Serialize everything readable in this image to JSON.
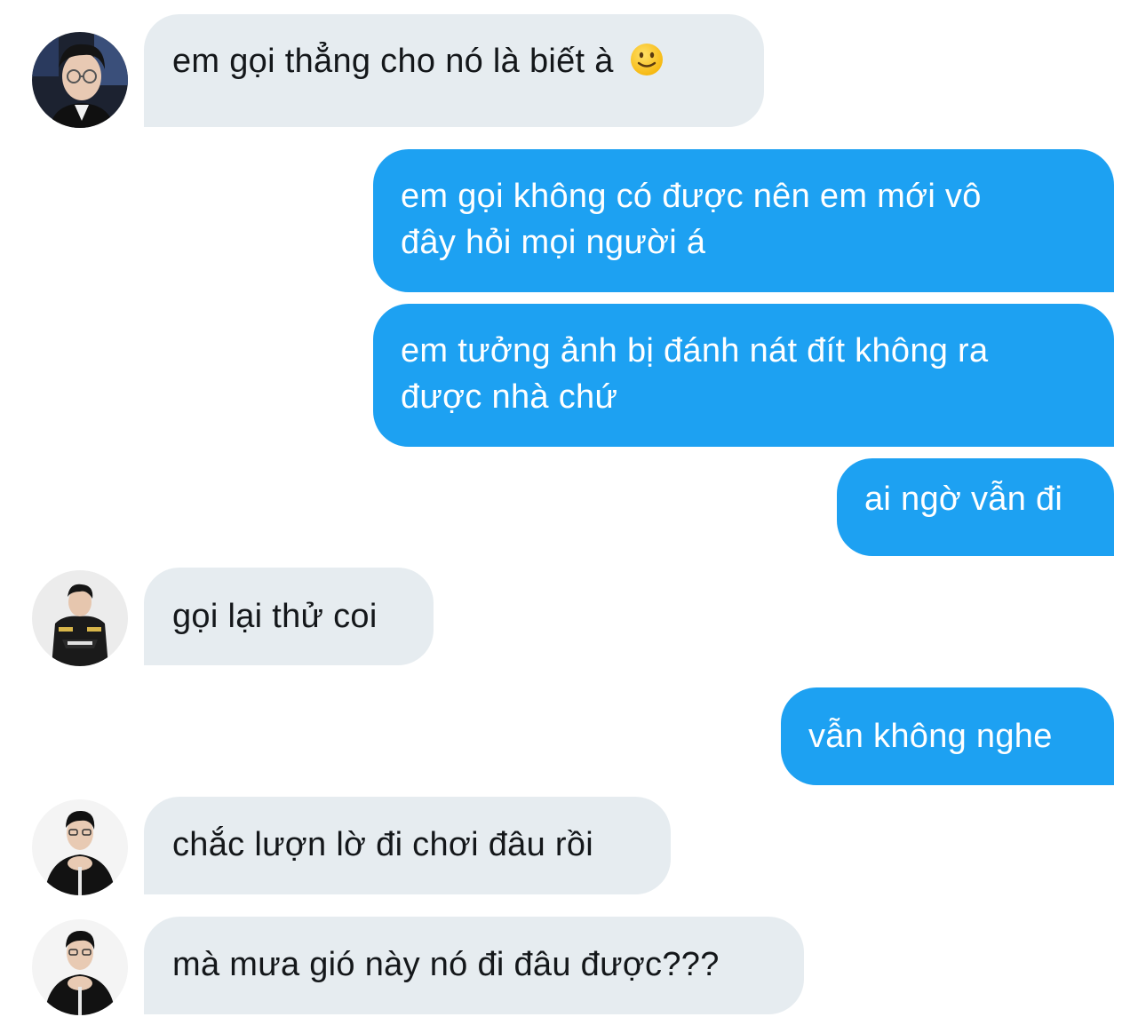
{
  "conversation": {
    "messages": [
      {
        "direction": "incoming",
        "text": "em gọi thẳng cho nó là biết à",
        "emoji": "slightly-smiling-face",
        "avatar": "avatar-glasses"
      },
      {
        "direction": "outgoing",
        "lines": [
          "em gọi không có được nên em mới vô",
          "đây hỏi mọi người á"
        ]
      },
      {
        "direction": "outgoing",
        "lines": [
          "em tưởng ảnh bị đánh nát đít không ra",
          "được nhà chứ"
        ]
      },
      {
        "direction": "outgoing",
        "text": "ai ngờ vẫn đi"
      },
      {
        "direction": "incoming",
        "text": "gọi lại thử coi",
        "avatar": "avatar-jacket"
      },
      {
        "direction": "outgoing",
        "text": "vẫn không nghe"
      },
      {
        "direction": "incoming",
        "text": "chắc lượn lờ đi chơi đâu rồi",
        "avatar": "avatar-hands"
      },
      {
        "direction": "incoming",
        "text": "mà mưa gió này nó đi đâu được???",
        "avatar": "avatar-hands"
      }
    ]
  },
  "colors": {
    "incoming_bubble": "#e6ecf0",
    "outgoing_bubble": "#1da1f2",
    "incoming_text": "#14171a",
    "outgoing_text": "#ffffff",
    "background": "#ffffff"
  }
}
